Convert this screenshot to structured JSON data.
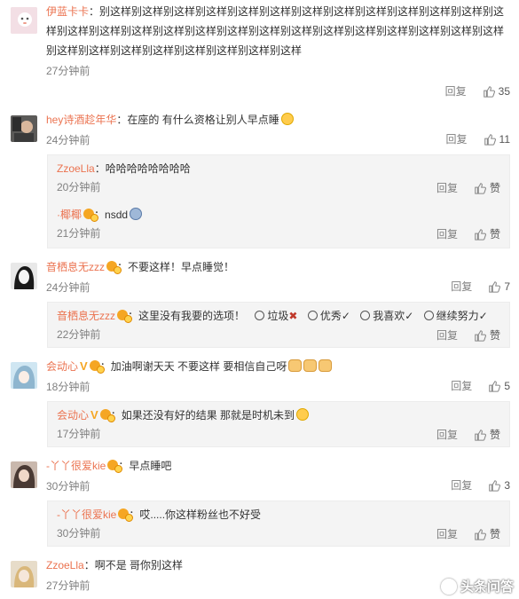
{
  "comments": [
    {
      "user": "伊蓝卡卡",
      "text": "别这样别这样别这样别这样别这样别这样别这样别这样别这样别这样别这样别这样别这样别这样别这样别这样别这样别这样别这样别这样别这样别这样别这样别这样别这样别这样别这样别这样别这样别这样别这样别这样别这样别这样别这样",
      "time": "27分钟前",
      "reply": "回复",
      "likes": "35"
    },
    {
      "user": "hey诗酒趁年华",
      "text": "在座的 有什么资格让别人早点睡",
      "time": "24分钟前",
      "reply": "回复",
      "likes": "11",
      "subs": [
        {
          "user": "ZzoeLla",
          "text": "哈哈哈哈哈哈哈哈",
          "time": "20分钟前",
          "reply": "回复",
          "like_label": "赞"
        },
        {
          "user": "·椰椰",
          "text": "nsdd",
          "time": "21分钟前",
          "reply": "回复",
          "like_label": "赞"
        }
      ]
    },
    {
      "user": "音栖息无zzz",
      "text": "不要这样！早点睡觉！",
      "time": "24分钟前",
      "reply": "回复",
      "likes": "7",
      "subs": [
        {
          "user": "音栖息无zzz",
          "text": "这里没有我要的选项！",
          "options": [
            "垃圾",
            "优秀✓",
            "我喜欢✓",
            "继续努力✓"
          ],
          "time": "22分钟前",
          "reply": "回复",
          "like_label": "赞"
        }
      ]
    },
    {
      "user": "会动心",
      "text": "加油啊谢天天 不要这样 要相信自己呀",
      "time": "18分钟前",
      "reply": "回复",
      "likes": "5",
      "subs": [
        {
          "user": "会动心",
          "text": "如果还没有好的结果 那就是时机未到",
          "time": "17分钟前",
          "reply": "回复",
          "like_label": "赞"
        }
      ]
    },
    {
      "user": "-丫丫很爱kie",
      "text": "早点睡吧",
      "time": "30分钟前",
      "reply": "回复",
      "likes": "3",
      "subs": [
        {
          "user": "-丫丫很爱kie",
          "text": "哎.....你这样粉丝也不好受",
          "time": "30分钟前",
          "reply": "回复",
          "like_label": "赞"
        }
      ]
    },
    {
      "user": "ZzoeLla",
      "text": "啊不是 哥你别这样",
      "time": "27分钟前"
    }
  ],
  "watermark": "头条问答",
  "colors": {
    "username": "#eb7350",
    "meta": "#808080",
    "subbg": "#f4f4f4"
  }
}
